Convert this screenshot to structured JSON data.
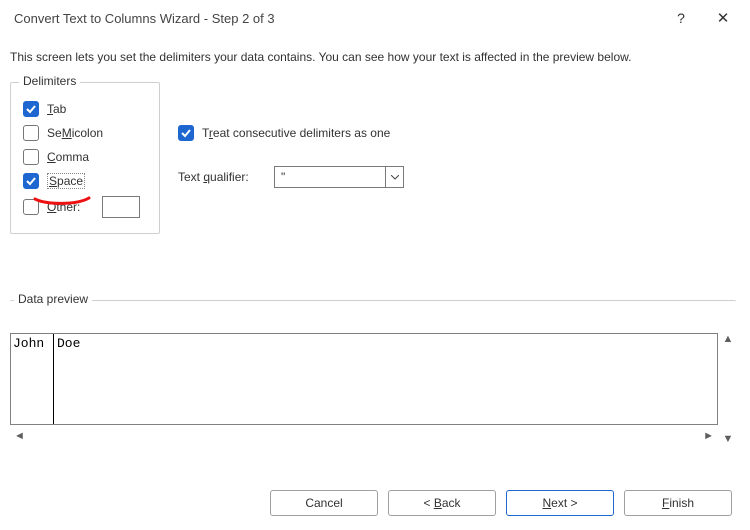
{
  "title": "Convert Text to Columns Wizard - Step 2 of 3",
  "description": "This screen lets you set the delimiters your data contains.  You can see how your text is affected in the preview below.",
  "delimiters": {
    "legend": "Delimiters",
    "tab": {
      "label": "Tab",
      "mn": "T",
      "rest": "ab",
      "checked": true
    },
    "semicolon": {
      "label": "Semicolon",
      "mn": "M",
      "pre": "Se",
      "rest": "icolon",
      "checked": false
    },
    "comma": {
      "label": "Comma",
      "mn": "C",
      "rest": "omma",
      "checked": false
    },
    "space": {
      "label": "Space",
      "mn": "S",
      "rest": "pace",
      "checked": true
    },
    "other": {
      "label": "Other:",
      "mn": "O",
      "rest": "ther:",
      "checked": false,
      "value": ""
    }
  },
  "consecutive": {
    "label": "Treat consecutive delimiters as one",
    "pre": "T",
    "mn": "r",
    "rest": "eat consecutive delimiters as one",
    "checked": true
  },
  "qualifier": {
    "label": "Text qualifier:",
    "pre": "Text ",
    "mn": "q",
    "rest": "ualifier:",
    "value": "\""
  },
  "preview": {
    "legend": "Data preview",
    "col1": "John",
    "col2": "Doe"
  },
  "buttons": {
    "cancel": "Cancel",
    "back_lt": "< ",
    "back_mn": "B",
    "back_rest": "ack",
    "next_mn": "N",
    "next_rest": "ext >",
    "finish_mn": "F",
    "finish_rest": "inish"
  }
}
